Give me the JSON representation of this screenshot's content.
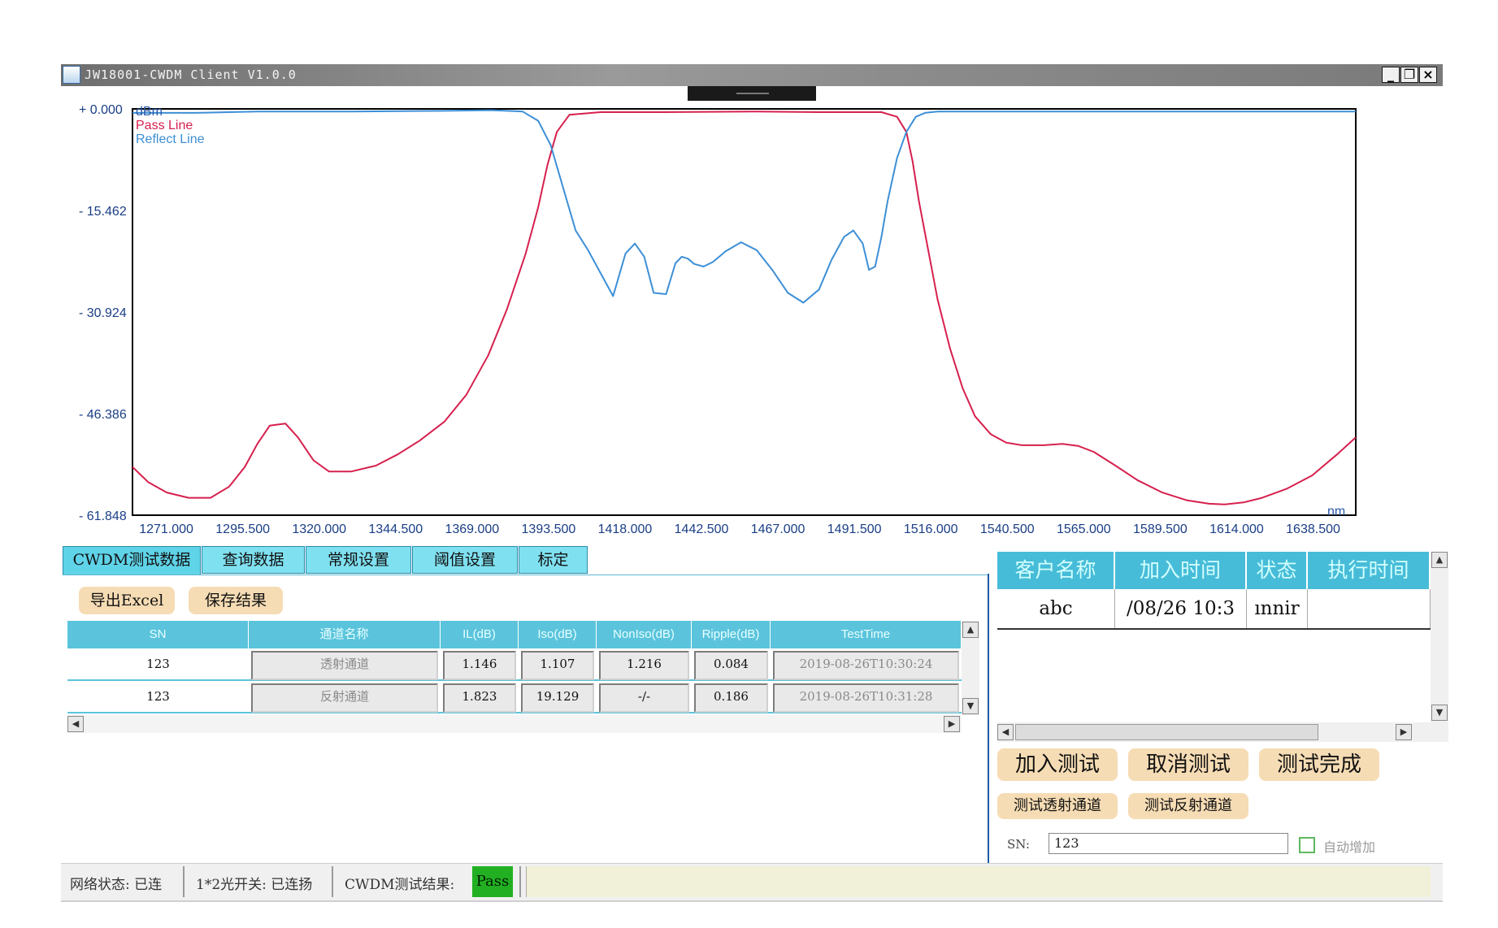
{
  "window": {
    "title": "JW18001-CWDM Client V1.0.0",
    "controls": [
      "_",
      "❐",
      "×"
    ]
  },
  "chart_data": {
    "type": "line",
    "ylabel": "dBm",
    "xlabel": "nm",
    "xlim": [
      1260,
      1652
    ],
    "ylim": [
      -61.848,
      0.0
    ],
    "x_ticks": [
      1271.0,
      1295.5,
      1320.0,
      1344.5,
      1369.0,
      1393.5,
      1418.0,
      1442.5,
      1467.0,
      1491.5,
      1516.0,
      1540.5,
      1565.0,
      1589.5,
      1614.0,
      1638.5
    ],
    "x_tick_labels": [
      "1271.000",
      "1295.500",
      "1320.000",
      "1344.500",
      "1369.000",
      "1393.500",
      "1418.000",
      "1442.500",
      "1467.000",
      "1491.500",
      "1516.000",
      "1540.500",
      "1565.000",
      "1589.500",
      "1614.000",
      "1638.500"
    ],
    "y_ticks": [
      0.0,
      -15.462,
      -30.924,
      -46.386,
      -61.848
    ],
    "y_tick_labels": [
      "0.000",
      "15.462",
      "30.924",
      "46.386",
      "61.848"
    ],
    "grid": true,
    "legend_position": "top-left",
    "series": [
      {
        "name": "Pass Line",
        "color": "#d6204e",
        "x": [
          1260,
          1265,
          1271,
          1278,
          1285,
          1291,
          1296,
          1300,
          1304,
          1309,
          1313,
          1318,
          1323,
          1330,
          1338,
          1345,
          1352,
          1360,
          1367,
          1374,
          1380,
          1386,
          1390,
          1393,
          1396,
          1400,
          1410,
          1430,
          1460,
          1480,
          1500,
          1505,
          1508,
          1510,
          1512,
          1515,
          1518,
          1522,
          1526,
          1530,
          1535,
          1540,
          1545,
          1552,
          1558,
          1563,
          1568,
          1575,
          1582,
          1590,
          1598,
          1605,
          1610,
          1616,
          1622,
          1630,
          1638,
          1646,
          1652
        ],
        "y": [
          -54.5,
          -56.8,
          -58.4,
          -59.2,
          -59.2,
          -57.5,
          -54.5,
          -51.0,
          -48.2,
          -47.9,
          -50.0,
          -53.5,
          -55.2,
          -55.2,
          -54.3,
          -52.6,
          -50.5,
          -47.6,
          -43.5,
          -37.5,
          -30.5,
          -22.0,
          -15.0,
          -8.5,
          -3.5,
          -0.9,
          -0.5,
          -0.5,
          -0.4,
          -0.5,
          -0.5,
          -1.2,
          -3.5,
          -8.0,
          -14.0,
          -21.5,
          -29.0,
          -36.5,
          -42.5,
          -46.8,
          -49.5,
          -50.8,
          -51.2,
          -51.2,
          -51.0,
          -51.3,
          -52.2,
          -54.3,
          -56.5,
          -58.4,
          -59.6,
          -60.1,
          -60.2,
          -59.9,
          -59.2,
          -57.8,
          -55.8,
          -52.6,
          -50.0
        ]
      },
      {
        "name": "Reflect Line",
        "color": "#3d8fd6",
        "x": [
          1260,
          1280,
          1300,
          1330,
          1360,
          1375,
          1385,
          1390,
          1394,
          1398,
          1402,
          1406,
          1410,
          1414,
          1418,
          1421,
          1424,
          1427,
          1431,
          1434,
          1436,
          1438,
          1440,
          1443,
          1446,
          1450,
          1455,
          1460,
          1465,
          1470,
          1475,
          1480,
          1484,
          1488,
          1491,
          1494,
          1496,
          1498,
          1500,
          1502,
          1505,
          1508,
          1511,
          1514,
          1518,
          1530,
          1560,
          1600,
          1630,
          1652
        ],
        "y": [
          -0.6,
          -0.6,
          -0.4,
          -0.4,
          -0.3,
          -0.2,
          -0.4,
          -1.8,
          -5.5,
          -12.0,
          -18.5,
          -21.5,
          -25.0,
          -28.5,
          -22.0,
          -20.5,
          -22.5,
          -28.0,
          -28.2,
          -23.5,
          -22.5,
          -22.8,
          -23.6,
          -24.0,
          -23.3,
          -21.7,
          -20.3,
          -21.5,
          -24.5,
          -28.0,
          -29.5,
          -27.5,
          -23.0,
          -19.5,
          -18.5,
          -20.5,
          -24.5,
          -24.0,
          -19.5,
          -14.0,
          -7.5,
          -3.5,
          -1.2,
          -0.6,
          -0.4,
          -0.4,
          -0.4,
          -0.4,
          -0.4,
          -0.4
        ]
      }
    ]
  },
  "tabs": [
    {
      "label": "CWDM测试数据",
      "active": true
    },
    {
      "label": "查询数据",
      "active": false
    },
    {
      "label": "常规设置",
      "active": false
    },
    {
      "label": "阈值设置",
      "active": false
    },
    {
      "label": "标定",
      "active": false
    }
  ],
  "actions": {
    "export_excel": "导出Excel",
    "save_result": "保存结果"
  },
  "grid": {
    "headers": [
      "SN",
      "通道名称",
      "IL(dB)",
      "Iso(dB)",
      "NonIso(dB)",
      "Ripple(dB)",
      "TestTime"
    ],
    "rows": [
      [
        "123",
        "透射通道",
        "1.146",
        "1.107",
        "1.216",
        "0.084",
        "2019-08-26T10:30:24"
      ],
      [
        "123",
        "反射通道",
        "1.823",
        "19.129",
        "-/-",
        "0.186",
        "2019-08-26T10:31:28"
      ]
    ]
  },
  "queue": {
    "headers": [
      "客户名称",
      "加入时间",
      "状态",
      "执行时间"
    ],
    "rows": [
      [
        "abc",
        "/08/26 10:3",
        "ınnir",
        ""
      ]
    ]
  },
  "controls": {
    "add_test": "加入测试",
    "cancel_test": "取消测试",
    "test_done": "测试完成",
    "test_pass_channel": "测试透射通道",
    "test_reflect_channel": "测试反射通道",
    "sn_label": "SN:",
    "sn_value": "123",
    "auto_increment": "自动增加"
  },
  "status": {
    "network": "网络状态: 已连",
    "switch": "1*2光开关: 已连扬",
    "cwdm_result_label": "CWDM测试结果:",
    "cwdm_result_value": "Pass",
    "pass_color": "#22b022"
  }
}
